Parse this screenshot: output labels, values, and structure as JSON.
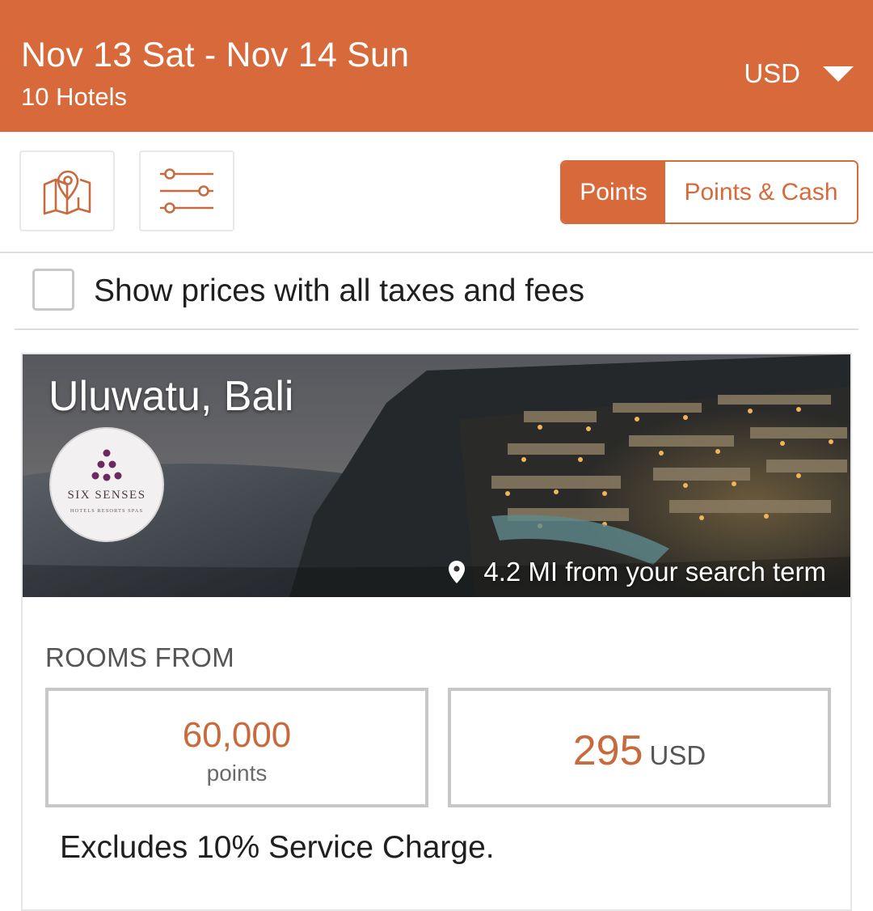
{
  "header": {
    "dates": "Nov 13 Sat - Nov 14 Sun",
    "hotel_count": "10 Hotels",
    "currency": "USD"
  },
  "toolbar": {
    "map_icon": "map-pin-icon",
    "filter_icon": "sliders-icon",
    "toggle": {
      "points_label": "Points",
      "points_cash_label": "Points & Cash",
      "selected": "Points"
    }
  },
  "taxes_checkbox": {
    "label": "Show prices with all taxes and fees",
    "checked": false
  },
  "hotel": {
    "location": "Uluwatu, Bali",
    "brand_logo": {
      "name": "SIX SENSES",
      "tagline": "HOTELS  RESORTS  SPAS"
    },
    "distance": "4.2 MI from your search term",
    "rooms_from_label": "ROOMS FROM",
    "points_price": "60,000",
    "points_unit": "points",
    "cash_price": "295",
    "cash_currency": "USD",
    "note": "Excludes 10% Service Charge."
  },
  "colors": {
    "accent": "#d8693a",
    "price": "#c76a3d",
    "logo_dots": "#6b2a5e"
  }
}
